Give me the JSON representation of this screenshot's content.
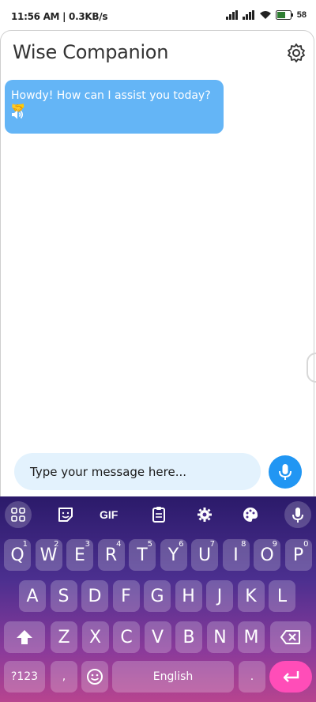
{
  "status": {
    "time": "11:56 AM | 0.3KB/s",
    "battery": "58"
  },
  "app": {
    "title": "Wise Companion"
  },
  "chat": {
    "messages": [
      {
        "from": "bot",
        "text": "Howdy! How can I assist you today? 🤝"
      }
    ]
  },
  "composer": {
    "placeholder": "Type your message here..."
  },
  "keyboard": {
    "toolbar": [
      "grid-icon",
      "sticker-icon",
      "GIF",
      "clipboard-icon",
      "settings-icon",
      "palette-icon",
      "mic-icon"
    ],
    "row1": [
      {
        "k": "Q",
        "n": "1"
      },
      {
        "k": "W",
        "n": "2"
      },
      {
        "k": "E",
        "n": "3"
      },
      {
        "k": "R",
        "n": "4"
      },
      {
        "k": "T",
        "n": "5"
      },
      {
        "k": "Y",
        "n": "6"
      },
      {
        "k": "U",
        "n": "7"
      },
      {
        "k": "I",
        "n": "8"
      },
      {
        "k": "O",
        "n": "9"
      },
      {
        "k": "P",
        "n": "0"
      }
    ],
    "row2": [
      "A",
      "S",
      "D",
      "F",
      "G",
      "H",
      "J",
      "K",
      "L"
    ],
    "row3": [
      "Z",
      "X",
      "C",
      "V",
      "B",
      "N",
      "M"
    ],
    "sym_label": "?123",
    "comma": ",",
    "space_label": "English",
    "period": "."
  }
}
